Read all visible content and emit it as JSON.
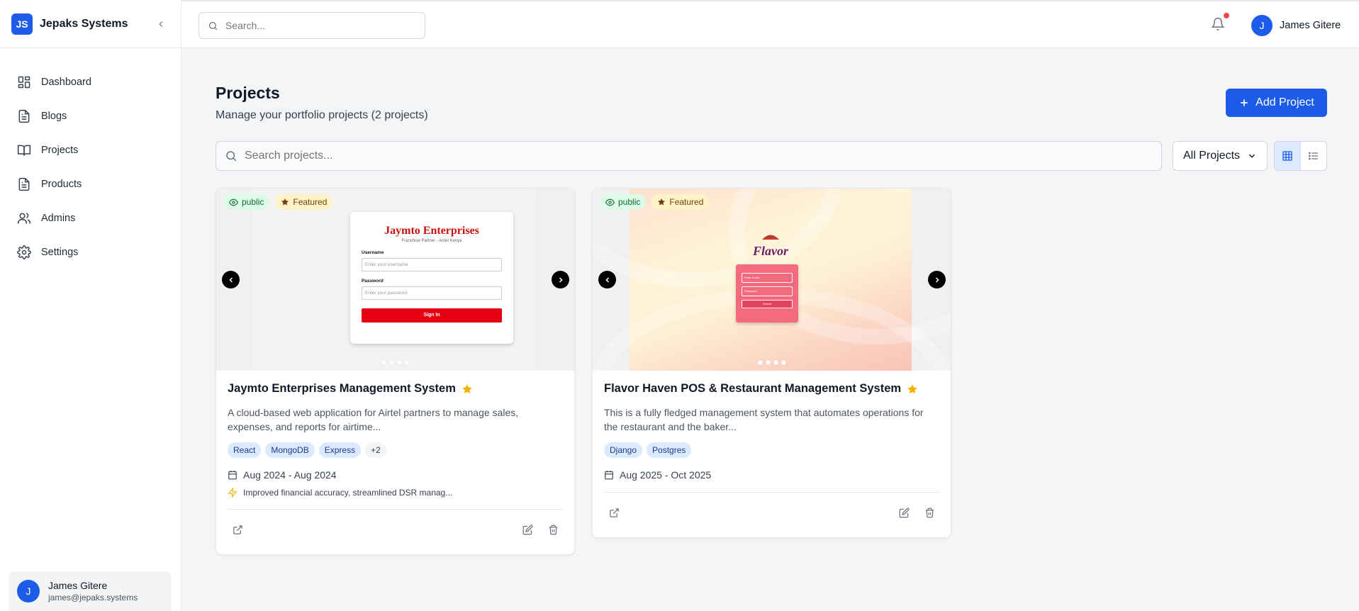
{
  "brand": {
    "logo_text": "JS",
    "name": "Jepaks Systems"
  },
  "sidebar": {
    "items": [
      {
        "label": "Dashboard",
        "icon": "dashboard-icon"
      },
      {
        "label": "Blogs",
        "icon": "document-icon"
      },
      {
        "label": "Projects",
        "icon": "book-icon"
      },
      {
        "label": "Products",
        "icon": "document-icon"
      },
      {
        "label": "Admins",
        "icon": "users-icon"
      },
      {
        "label": "Settings",
        "icon": "gear-icon"
      }
    ],
    "user": {
      "initial": "J",
      "name": "James Gitere",
      "email": "james@jepaks.systems"
    }
  },
  "topbar": {
    "search_placeholder": "Search...",
    "user": {
      "initial": "J",
      "name": "James Gitere"
    }
  },
  "page": {
    "title": "Projects",
    "subtitle": "Manage your portfolio projects (2 projects)",
    "add_button": "Add Project",
    "search_placeholder": "Search projects...",
    "filter_value": "All Projects"
  },
  "projects": [
    {
      "visibility": "public",
      "featured": "Featured",
      "title": "Jaymto Enterprises Management System",
      "description": "A cloud-based web application for Airtel partners to manage sales, expenses, and reports for airtime...",
      "tags": [
        "React",
        "MongoDB",
        "Express",
        "+2"
      ],
      "dates": "Aug 2024 - Aug 2024",
      "impact": "Improved financial accuracy, streamlined DSR manag...",
      "preview": {
        "title": "Jaymto Enterprises",
        "subtitle": "Franchise Partner - Airtel Kenya",
        "username_label": "Username",
        "username_placeholder": "Enter your username",
        "password_label": "Password",
        "password_placeholder": "Enter your password",
        "button": "Sign In"
      }
    },
    {
      "visibility": "public",
      "featured": "Featured",
      "title": "Flavor Haven POS & Restaurant Management System",
      "description": "This is a fully fledged management system that automates operations for the restaurant and the baker...",
      "tags": [
        "Django",
        "Postgres"
      ],
      "dates": "Aug 2025 - Oct 2025",
      "preview": {
        "logo": "Flavor",
        "field1": "Enter Email",
        "field2": "Password",
        "button": "Submit"
      }
    }
  ],
  "colors": {
    "accent": "#1d5ce8",
    "star": "#f5b301",
    "notification": "#ef4444"
  }
}
